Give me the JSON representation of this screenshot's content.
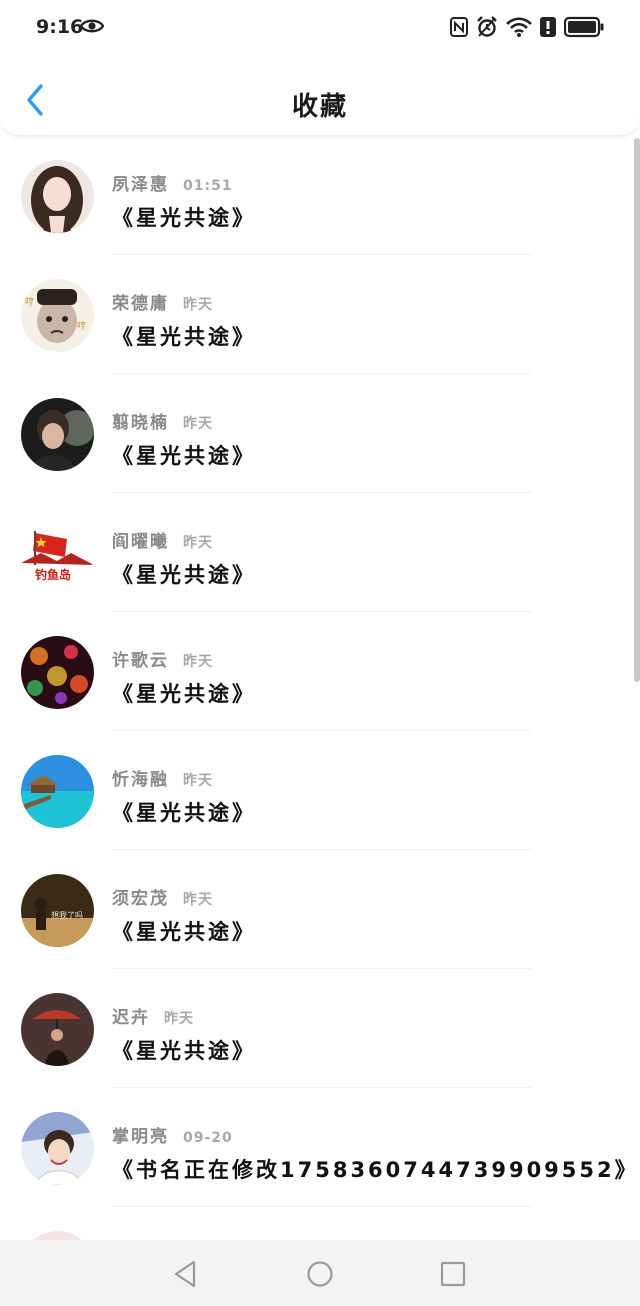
{
  "status_bar": {
    "time": "9:16",
    "icons": [
      "eye-icon",
      "nfc-icon",
      "alarm-icon",
      "wifi-icon",
      "alert-icon",
      "battery-icon"
    ]
  },
  "header": {
    "title": "收藏",
    "back_icon": "chevron-left-icon"
  },
  "colors": {
    "accent": "#2f9bf0",
    "name_text": "#8a8a8a",
    "title_text": "#111111"
  },
  "favorites": [
    {
      "name": "夙泽惠",
      "time": "01:51",
      "book": "《星光共途》"
    },
    {
      "name": "荣德庸",
      "time": "昨天",
      "book": "《星光共途》"
    },
    {
      "name": "翦晓楠",
      "time": "昨天",
      "book": "《星光共途》"
    },
    {
      "name": "阎曜曦",
      "time": "昨天",
      "book": "《星光共途》"
    },
    {
      "name": "许歌云",
      "time": "昨天",
      "book": "《星光共途》"
    },
    {
      "name": "忻海融",
      "time": "昨天",
      "book": "《星光共途》"
    },
    {
      "name": "须宏茂",
      "time": "昨天",
      "book": "《星光共途》"
    },
    {
      "name": "迟卉",
      "time": "昨天",
      "book": "《星光共途》"
    },
    {
      "name": "掌明亮",
      "time": "09-20",
      "book": "《书名正在修改1758360744739909552》"
    }
  ],
  "nav_bar": {
    "icons": [
      "back-triangle-icon",
      "home-circle-icon",
      "recents-square-icon"
    ]
  }
}
